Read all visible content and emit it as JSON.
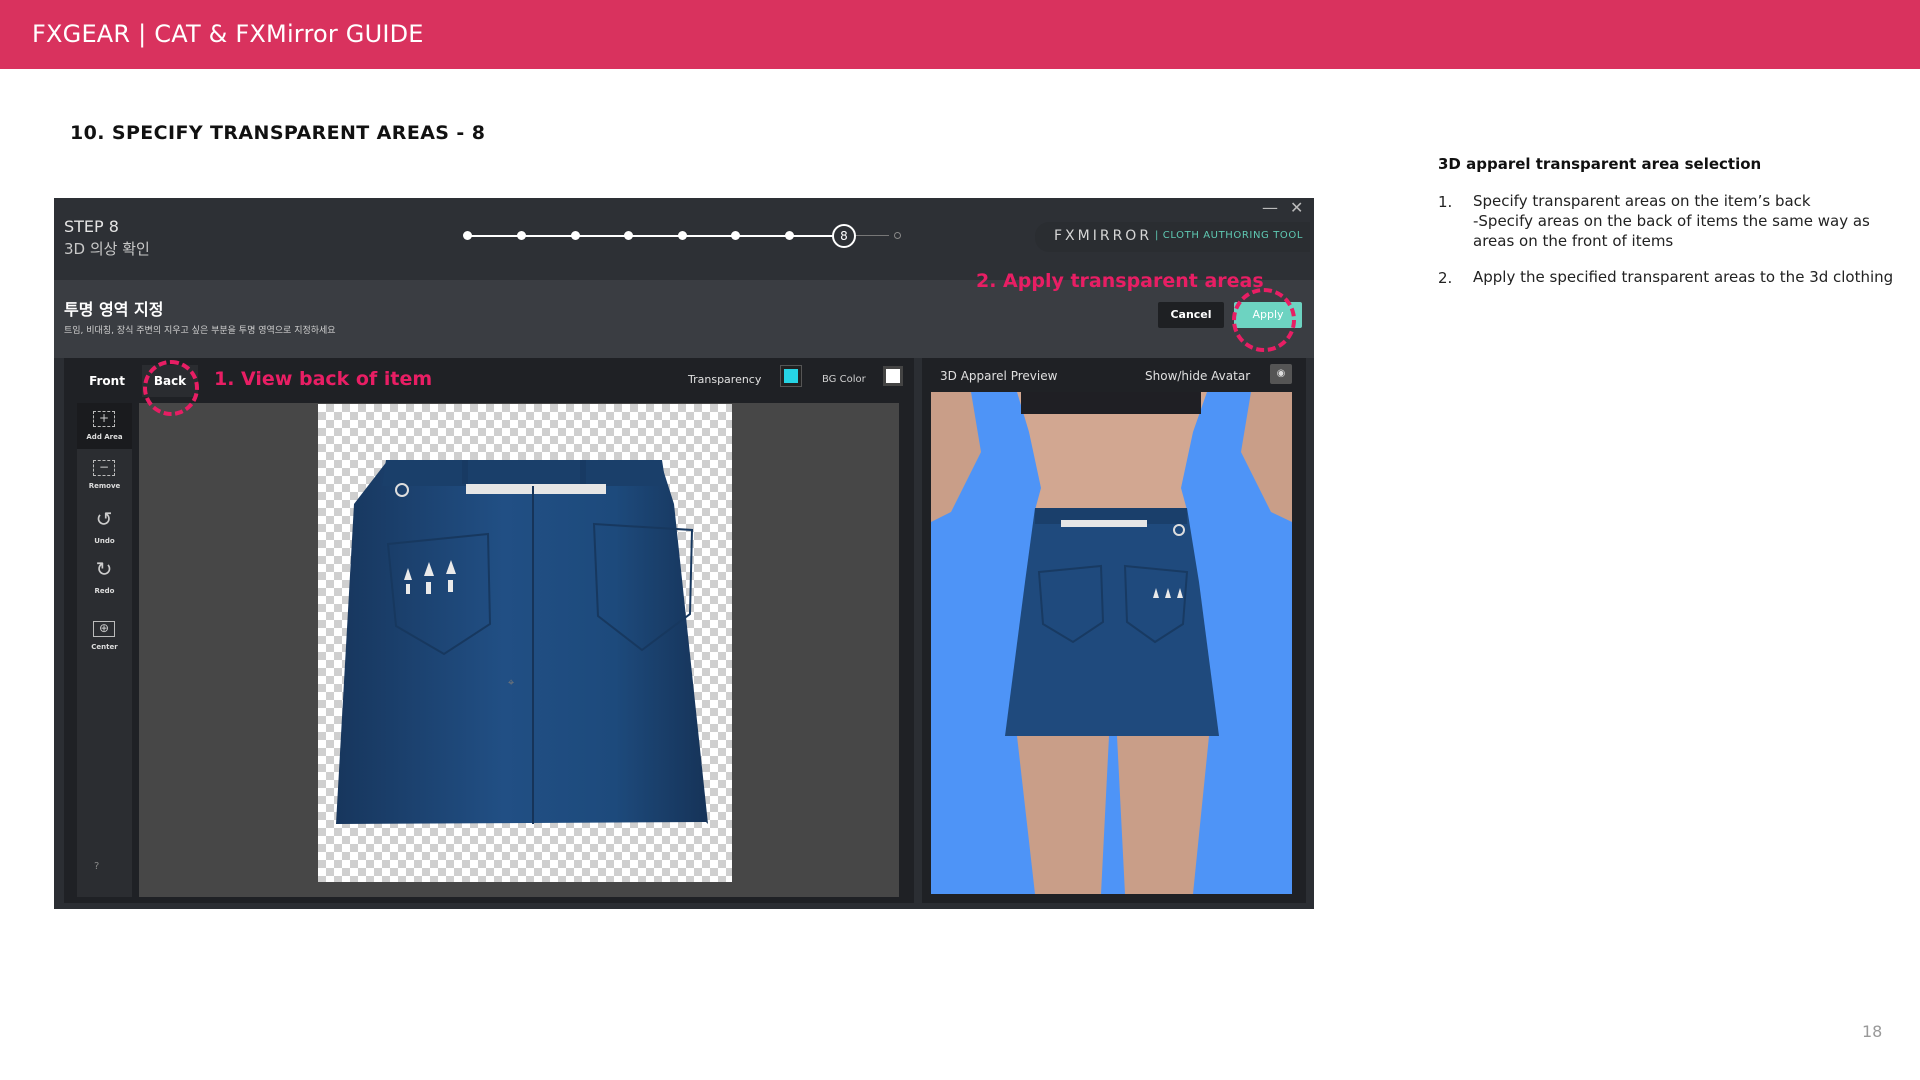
{
  "header": {
    "title": "FXGEAR | CAT & FXMirror GUIDE"
  },
  "section": {
    "title": "10. SPECIFY TRANSPARENT AREAS - 8"
  },
  "app": {
    "step_label": "STEP 8",
    "step_sub": "3D 의상 확인",
    "window_minimize": "—",
    "window_close": "✕",
    "progress_current": "8",
    "brand_name": "FXMIRROR",
    "brand_sub": "| CLOTH AUTHORING TOOL",
    "sub_title": "투명 영역 지정",
    "sub_desc": "트임, 비대칭, 장식 주변의 지우고 싶은 부분을 투명 영역으로 지정하세요",
    "cancel_label": "Cancel",
    "apply_label": "Apply",
    "tab_front": "Front",
    "tab_back": "Back",
    "transparency_label": "Transparency",
    "bgcolor_label": "BG Color",
    "tools": [
      {
        "label": "Add Area",
        "icon": "+"
      },
      {
        "label": "Remove",
        "icon": "−"
      },
      {
        "label": "Undo",
        "icon": "↺"
      },
      {
        "label": "Redo",
        "icon": "↻"
      },
      {
        "label": "Center",
        "icon": "⊕"
      }
    ],
    "help": "?",
    "preview_title": "3D Apparel Preview",
    "preview_avatar": "Show/hide Avatar",
    "colors": {
      "accent": "#6dd3c1",
      "transparency_swatch": "#26d4e4",
      "preview_bg": "#4e94f7",
      "skirt": "#1e4a7e"
    }
  },
  "annotations": {
    "view_back": "1. View back of item",
    "apply_areas": "2. Apply transparent areas"
  },
  "right_column": {
    "title": "3D apparel transparent area selection",
    "items": [
      {
        "num": "1.",
        "lines": [
          "Specify transparent areas on the item’s back",
          "-Specify areas on the back of items the same way as",
          "areas on the front of items"
        ]
      },
      {
        "num": "2.",
        "lines": [
          "Apply the specified transparent areas to the 3d clothing"
        ]
      }
    ]
  },
  "page_number": "18"
}
